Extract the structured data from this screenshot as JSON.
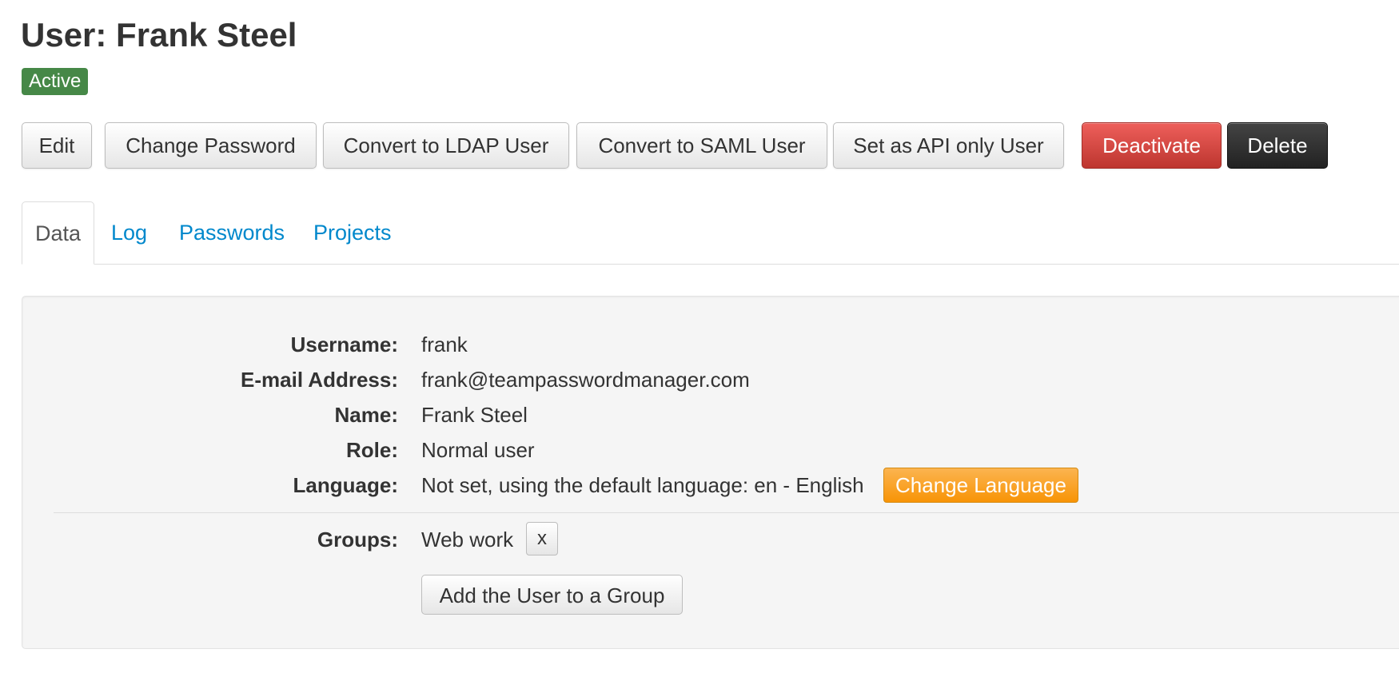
{
  "header": {
    "title": "User: Frank Steel",
    "status": "Active"
  },
  "toolbar": {
    "edit": "Edit",
    "change_password": "Change Password",
    "convert_ldap": "Convert to LDAP User",
    "convert_saml": "Convert to SAML User",
    "api_only": "Set as API only User",
    "deactivate": "Deactivate",
    "delete": "Delete"
  },
  "tabs": [
    {
      "label": "Data",
      "active": true
    },
    {
      "label": "Log",
      "active": false
    },
    {
      "label": "Passwords",
      "active": false
    },
    {
      "label": "Projects",
      "active": false
    }
  ],
  "details": {
    "username_label": "Username:",
    "username": "frank",
    "email_label": "E-mail Address:",
    "email": "frank@teampasswordmanager.com",
    "name_label": "Name:",
    "name": "Frank Steel",
    "role_label": "Role:",
    "role": "Normal user",
    "language_label": "Language:",
    "language": "Not set, using the default language: en - English",
    "change_language": "Change Language",
    "groups_label": "Groups:",
    "groups": [
      {
        "name": "Web work",
        "remove_label": "x"
      }
    ],
    "add_to_group": "Add the User to a Group"
  },
  "colors": {
    "active_badge": "#468847",
    "danger": "#da4f49",
    "inverse": "#222222",
    "warning": "#f89406",
    "link": "#0088cc"
  }
}
